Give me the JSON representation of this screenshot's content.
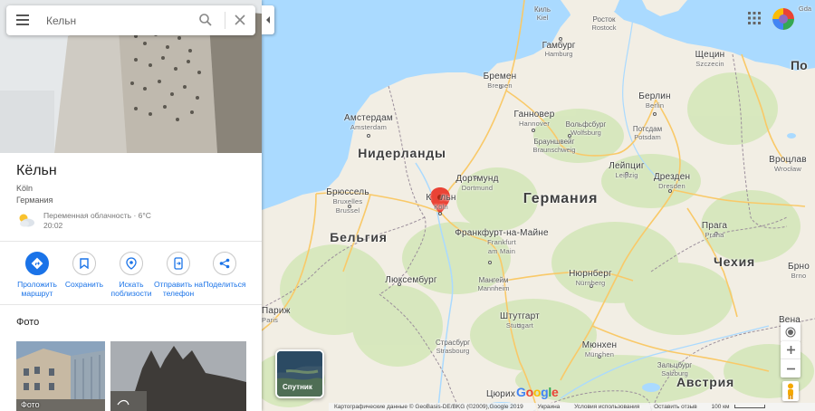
{
  "search": {
    "value": "Кельн"
  },
  "place": {
    "title": "Кёльн",
    "subtitle": "Köln",
    "country": "Германия",
    "weather": "Переменная облачность · 6°C",
    "time": "20:02"
  },
  "actions": [
    {
      "label": "Проложить маршрут",
      "icon": "directions-icon"
    },
    {
      "label": "Сохранить",
      "icon": "bookmark-icon"
    },
    {
      "label": "Искать поблизости",
      "icon": "nearby-icon"
    },
    {
      "label": "Отправить на телефон",
      "icon": "send-to-phone-icon"
    },
    {
      "label": "Поделиться",
      "icon": "share-icon"
    }
  ],
  "photos": {
    "heading": "Фото",
    "caption": "Фото"
  },
  "map": {
    "satellite_label": "Спутник",
    "countries": {
      "netherlands": "Нидерланды",
      "germany": "Германия",
      "belgium": "Бельгия",
      "czech": "Чехия",
      "austria": "Австрия",
      "poland_partial": "По"
    },
    "cities": {
      "kiel": "Киль",
      "kiel_sub": "Kiel",
      "rostock": "Росток",
      "rostock_sub": "Rostock",
      "hamburg": "Гамбург",
      "hamburg_sub": "Hamburg",
      "szczecin": "Щецин",
      "szczecin_sub": "Szczecin",
      "gdansk_sub": "Gda",
      "bremen": "Бремен",
      "bremen_sub": "Bremen",
      "amsterdam": "Амстердам",
      "amsterdam_sub": "Amsterdam",
      "hannover": "Ганновер",
      "hannover_sub": "Hannover",
      "berlin": "Берлин",
      "berlin_sub": "Berlin",
      "braunschweig": "Брауншвейг",
      "braunschweig_sub": "Braunschweig",
      "wolfsburg": "Вольфсбург",
      "wolfsburg_sub": "Wolfsburg",
      "potsdam": "Потсдам",
      "potsdam_sub": "Potsdam",
      "dortmund": "Дортмунд",
      "dortmund_sub": "Dortmund",
      "leipzig": "Лейпциг",
      "leipzig_sub": "Leipzig",
      "wroclaw": "Вроцлав",
      "wroclaw_sub": "Wrocław",
      "cologne_a": "К",
      "cologne_b": "льн",
      "cologne_sub": "Köln",
      "brussels": "Брюссель",
      "brussels_sub_1": "Bruxelles",
      "brussels_sub_2": "Brussel",
      "dresden": "Дрезден",
      "dresden_sub": "Dresden",
      "frankfurt": "Франкфурт-на-Майне",
      "frankfurt_sub_1": "Frankfurt",
      "frankfurt_sub_2": "am Main",
      "prague": "Прага",
      "prague_sub": "Praha",
      "luxembourg": "Люксембург",
      "nuremberg": "Нюрнберг",
      "nuremberg_sub": "Nürnberg",
      "brno": "Брно",
      "brno_sub": "Brno",
      "mannheim": "Мангейм",
      "mannheim_sub": "Mannheim",
      "paris": "Париж",
      "paris_sub": "Paris",
      "stuttgart": "Штутгарт",
      "stuttgart_sub": "Stuttgart",
      "vienna": "Вена",
      "strasbourg": "Страсбург",
      "strasbourg_sub": "Strasbourg",
      "munich": "Мюнхен",
      "munich_sub": "München",
      "salzburg": "Зальцбург",
      "salzburg_sub": "Salzburg",
      "zurich": "Цюрих"
    },
    "google_logo": [
      "G",
      "o",
      "o",
      "g",
      "l",
      "e"
    ],
    "colors": {
      "water": "#aadaff",
      "land": "#f2eee4",
      "green": "#cfe5b2",
      "pin": "#ea4335",
      "highway": "#f9c968",
      "border": "#9b8e9b"
    }
  },
  "footer": {
    "attribution": "Картографические данные © GeoBasis-DE/BKG (©2009),Google 2019",
    "country": "Украина",
    "terms": "Условия использования",
    "feedback": "Оставить отзыв",
    "scale": "100 км"
  }
}
